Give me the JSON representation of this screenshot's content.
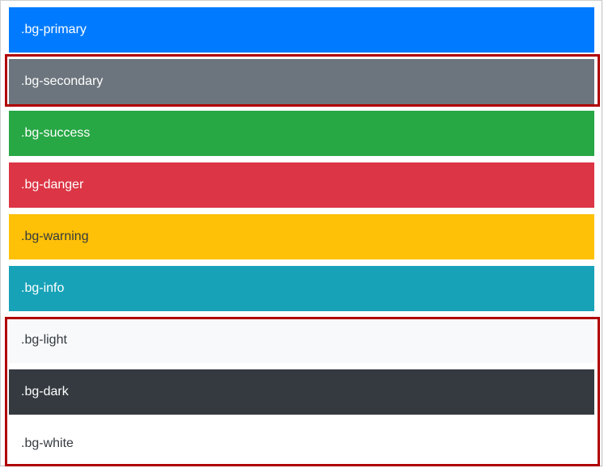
{
  "swatches": [
    {
      "label": ".bg-primary",
      "bg": "#007bff",
      "fg": "#ffffff"
    },
    {
      "label": ".bg-secondary",
      "bg": "#6c757d",
      "fg": "#ffffff"
    },
    {
      "label": ".bg-success",
      "bg": "#28a745",
      "fg": "#ffffff"
    },
    {
      "label": ".bg-danger",
      "bg": "#dc3545",
      "fg": "#ffffff"
    },
    {
      "label": ".bg-warning",
      "bg": "#ffc107",
      "fg": "#343a40"
    },
    {
      "label": ".bg-info",
      "bg": "#17a2b8",
      "fg": "#ffffff"
    },
    {
      "label": ".bg-light",
      "bg": "#f8f9fa",
      "fg": "#343a40"
    },
    {
      "label": ".bg-dark",
      "bg": "#343a40",
      "fg": "#ffffff"
    },
    {
      "label": ".bg-white",
      "bg": "#ffffff",
      "fg": "#343a40"
    }
  ],
  "highlight_color": "#b00000"
}
